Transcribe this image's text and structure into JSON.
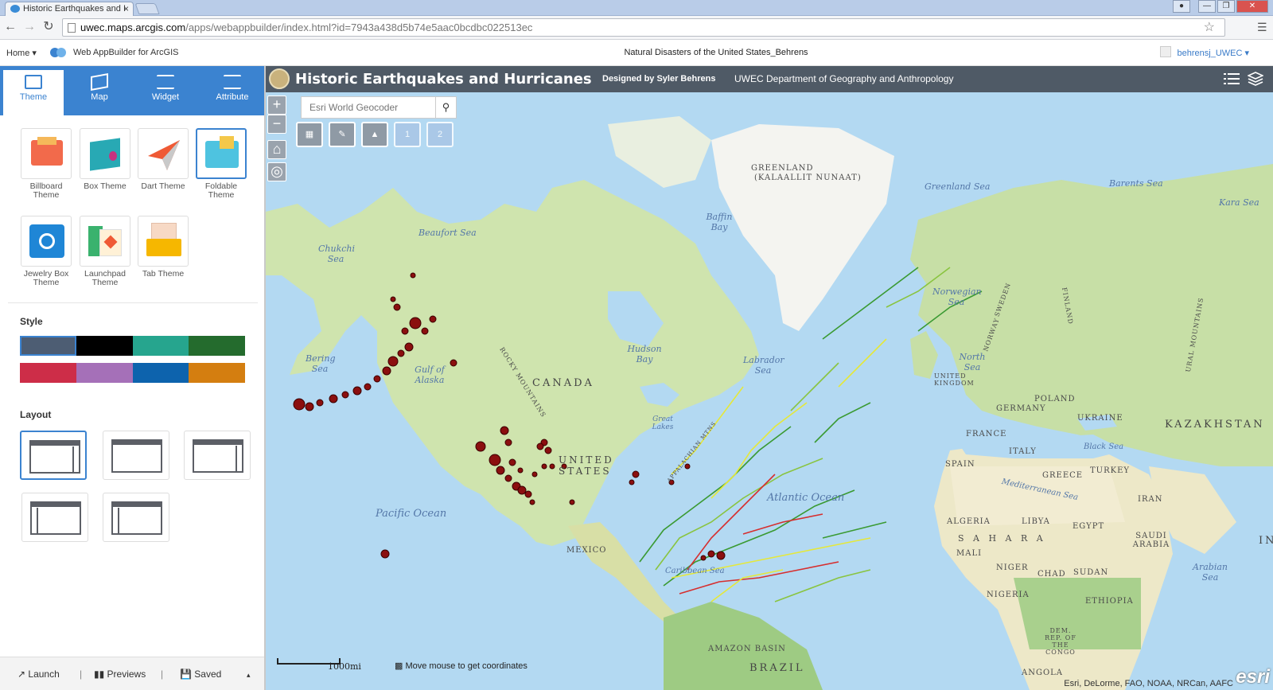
{
  "browser": {
    "tab_title": "Historic Earthquakes and I",
    "tab_close": "×",
    "url_domain": "uwec.maps.arcgis.com",
    "url_path": "/apps/webappbuilder/index.html?id=7943a438d5b74e5aac0bcdbc022513ec"
  },
  "builder_header": {
    "home": "Home ▾",
    "product": "Web AppBuilder for ArcGIS",
    "app_name": "Natural Disasters of the United States_Behrens",
    "user": "behrensj_UWEC ▾"
  },
  "panel_tabs": [
    {
      "label": "Theme"
    },
    {
      "label": "Map"
    },
    {
      "label": "Widget"
    },
    {
      "label": "Attribute"
    }
  ],
  "themes": [
    {
      "label": "Billboard Theme"
    },
    {
      "label": "Box Theme"
    },
    {
      "label": "Dart Theme"
    },
    {
      "label": "Foldable Theme"
    },
    {
      "label": "Jewelry Box Theme"
    },
    {
      "label": "Launchpad Theme"
    },
    {
      "label": "Tab Theme"
    }
  ],
  "style": {
    "title": "Style",
    "colors": [
      "#4d5d73",
      "#000000",
      "#26a58e",
      "#246b2d",
      "#cd2d48",
      "#a570b8",
      "#0d63ad",
      "#d47e10"
    ]
  },
  "layout": {
    "title": "Layout"
  },
  "bottom_bar": {
    "launch": "Launch",
    "sep": "|",
    "previews": "Previews",
    "saved": "Saved",
    "caret": "▴"
  },
  "map_header": {
    "title": "Historic Earthquakes and Hurricanes",
    "subtitle": "Designed by Syler Behrens",
    "link": "UWEC Department of Geography and Anthropology"
  },
  "map_controls": {
    "zoom_in": "+",
    "zoom_out": "−",
    "geocoder_placeholder": "Esri World Geocoder",
    "page_1": "1",
    "page_2": "2"
  },
  "map_footer": {
    "scale": "1000mi",
    "coords": "Move mouse to get coordinates",
    "attribution": "Esri, DeLorme, FAO, NOAA, NRCan, AAFC",
    "esri": "esri"
  },
  "map_labels": {
    "greenland": "GREENLAND",
    "greenland_native": "(KALAALLIT NUNAAT)",
    "greenland_sea": "Greenland Sea",
    "barents_sea": "Barents Sea",
    "kara_sea": "Kara Sea",
    "baffin_bay": "Baffin Bay",
    "beaufort_sea": "Beaufort Sea",
    "chukchi_sea": "Chukchi Sea",
    "norwegian_sea": "Norwegian Sea",
    "hudson_bay": "Hudson Bay",
    "labrador_sea": "Labrador Sea",
    "bering_sea": "Bering Sea",
    "gulf_of_alaska": "Gulf of Alaska",
    "canada": "CANADA",
    "united_states": "UNITED STATES",
    "mexico": "MEXICO",
    "pacific_ocean": "Pacific Ocean",
    "atlantic_ocean": "Atlantic Ocean",
    "north_sea": "North Sea",
    "united_kingdom": "UNITED KINGDOM",
    "poland": "POLAND",
    "germany": "GERMANY",
    "ukraine": "UKRAINE",
    "france": "FRANCE",
    "kazakhstan": "KAZAKHSTAN",
    "spain": "SPAIN",
    "italy": "ITALY",
    "greece": "GREECE",
    "turkey": "TURKEY",
    "black_sea": "Black Sea",
    "mediterranean": "Mediterranean Sea",
    "iran": "IRAN",
    "algeria": "ALGERIA",
    "libya": "LIBYA",
    "egypt": "EGYPT",
    "sahara": "S A H A R A",
    "saudi_arabia": "SAUDI ARABIA",
    "mali": "MALI",
    "niger": "NIGER",
    "chad": "CHAD",
    "sudan": "SUDAN",
    "nigeria": "NIGERIA",
    "ethiopia": "ETHIOPIA",
    "arabian_sea": "Arabian Sea",
    "drc": "DEM. REP. OF THE CONGO",
    "angola": "ANGOLA",
    "brazil": "BRAZIL",
    "amazon_basin": "AMAZON BASIN",
    "caribbean": "Caribbean Sea",
    "great_lakes": "Great Lakes",
    "rocky_mountains": "ROCKY MOUNTAINS",
    "appalachian": "APPALACHIAN MTNS",
    "ural": "URAL MOUNTAINS",
    "sweden": "SWEDEN",
    "finland": "FINLAND",
    "norway": "NORWAY",
    "in": "IN"
  }
}
